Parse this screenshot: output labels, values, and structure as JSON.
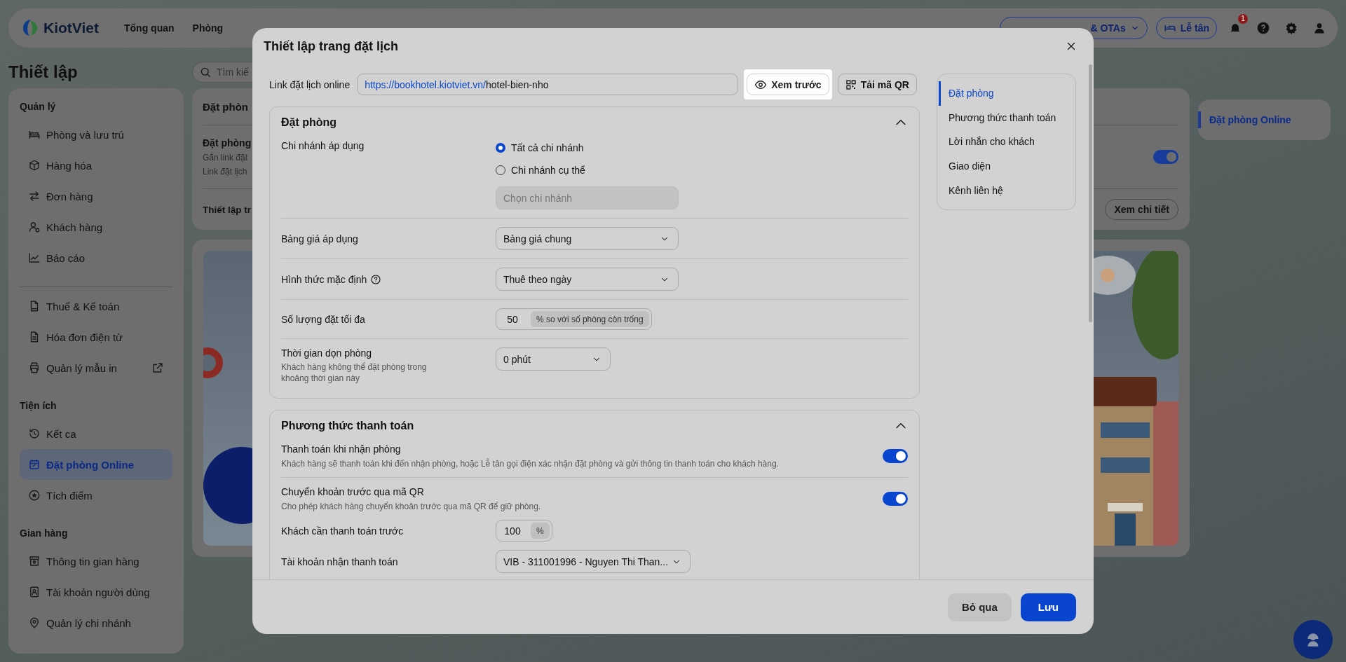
{
  "top_nav": {
    "logo": "KiotViet",
    "items": [
      {
        "label": "Tổng quan"
      },
      {
        "label": "Phòng"
      }
    ],
    "sales_channel_button": "& OTAs",
    "reception_button": "Lễ tân",
    "notification_count": "1"
  },
  "page": {
    "title": "Thiết lập",
    "search": {
      "placeholder": "Tìm kiế"
    }
  },
  "sidebar": {
    "groups": [
      {
        "title": "Quản lý",
        "items": [
          {
            "label": "Phòng và lưu trú",
            "kind": "link",
            "selected": false
          },
          {
            "label": "Hàng hóa",
            "kind": "link",
            "selected": false
          },
          {
            "label": "Đơn hàng",
            "kind": "link",
            "selected": false
          },
          {
            "label": "Khách hàng",
            "kind": "link",
            "selected": false
          },
          {
            "label": "Báo cáo",
            "kind": "link",
            "selected": false
          }
        ]
      },
      {
        "items": [
          {
            "label": "Thuế & Kế toán",
            "kind": "link",
            "selected": false
          },
          {
            "label": "Hóa đơn điện tử",
            "kind": "link",
            "selected": false
          },
          {
            "label": "Quản lý mẫu in",
            "kind": "external",
            "selected": false
          }
        ]
      },
      {
        "title": "Tiện ích",
        "items": [
          {
            "label": "Kết ca",
            "kind": "link",
            "selected": false
          },
          {
            "label": "Đặt phòng Online",
            "kind": "link",
            "selected": true
          },
          {
            "label": "Tích điểm",
            "kind": "link",
            "selected": false
          }
        ]
      },
      {
        "title": "Gian hàng",
        "items": [
          {
            "label": "Thông tin gian hàng",
            "kind": "link",
            "selected": false
          },
          {
            "label": "Tài khoản người dùng",
            "kind": "link",
            "selected": false
          },
          {
            "label": "Quản lý chi nhánh",
            "kind": "link",
            "selected": false
          }
        ]
      }
    ]
  },
  "settings_card": {
    "title": "Đặt phòn",
    "feature": {
      "title": "Đặt phòng",
      "lines": [
        "Gắn link đặt",
        "Link đặt lịch"
      ],
      "on": true
    },
    "footer": {
      "label": "Thiết lập tr",
      "button": "Xem chi tiết"
    }
  },
  "right_menu": {
    "items": [
      {
        "label": "Đặt phòng Online",
        "selected": true
      }
    ]
  },
  "modal": {
    "title": "Thiết lập trang đặt lịch",
    "link": {
      "label": "Link đặt lịch online",
      "base": "https://bookhotel.kiotviet.vn/",
      "slug": "hotel-bien-nho"
    },
    "preview_button": {
      "label": "Xem trước",
      "highlighted": true
    },
    "qr_button": "Tải mã QR",
    "sections": [
      {
        "title": "Đặt phòng",
        "expanded": true,
        "fields": [
          {
            "kind": "radio",
            "label": "Chi nhánh áp dụng",
            "options": [
              {
                "label": "Tất cả chi nhánh",
                "selected": true
              },
              {
                "label": "Chi nhánh cụ thể",
                "selected": false
              }
            ],
            "select": {
              "placeholder": "Chọn chi nhánh",
              "disabled": true
            }
          },
          {
            "kind": "select",
            "label": "Bảng giá áp dụng",
            "value": "Bảng giá chung"
          },
          {
            "kind": "select",
            "label": "Hình thức mặc định",
            "help": true,
            "value": "Thuê theo ngày"
          },
          {
            "kind": "number",
            "label": "Số lượng đặt tối đa",
            "value": "50",
            "unit": "% so với số phòng còn trống"
          },
          {
            "kind": "select",
            "label": "Thời gian dọn phòng",
            "hint": "Khách hàng không thể đặt phòng trong khoảng thời gian này",
            "value": "0 phút",
            "compact": true
          }
        ]
      },
      {
        "title": "Phương thức thanh toán",
        "expanded": true,
        "fields": [
          {
            "kind": "toggle",
            "label": "Thanh toán khi nhận phòng",
            "description": "Khách hàng sẽ thanh toán khi đến nhận phòng, hoặc Lễ tân gọi điện xác nhận đặt phòng và gửi thông tin thanh toán cho khách hàng.",
            "on": true
          },
          {
            "kind": "toggle",
            "label": "Chuyển khoản trước qua mã QR",
            "description": "Cho phép khách hàng chuyển khoản trước qua mã QR để giữ phòng.",
            "on": true,
            "children": [
              {
                "kind": "number",
                "label": "Khách cần thanh toán trước",
                "value": "100",
                "unit": "%"
              },
              {
                "kind": "select",
                "label": "Tài khoản nhận thanh toán",
                "value": "VIB - 311001996 - Nguyen Thi Than..."
              }
            ]
          }
        ]
      }
    ],
    "nav": [
      {
        "label": "Đặt phòng",
        "selected": true
      },
      {
        "label": "Phương thức thanh toán",
        "selected": false
      },
      {
        "label": "Lời nhắn cho khách",
        "selected": false
      },
      {
        "label": "Giao diện",
        "selected": false
      },
      {
        "label": "Kênh liên hệ",
        "selected": false
      }
    ],
    "buttons": {
      "cancel": "Bỏ qua",
      "save": "Lưu"
    }
  }
}
